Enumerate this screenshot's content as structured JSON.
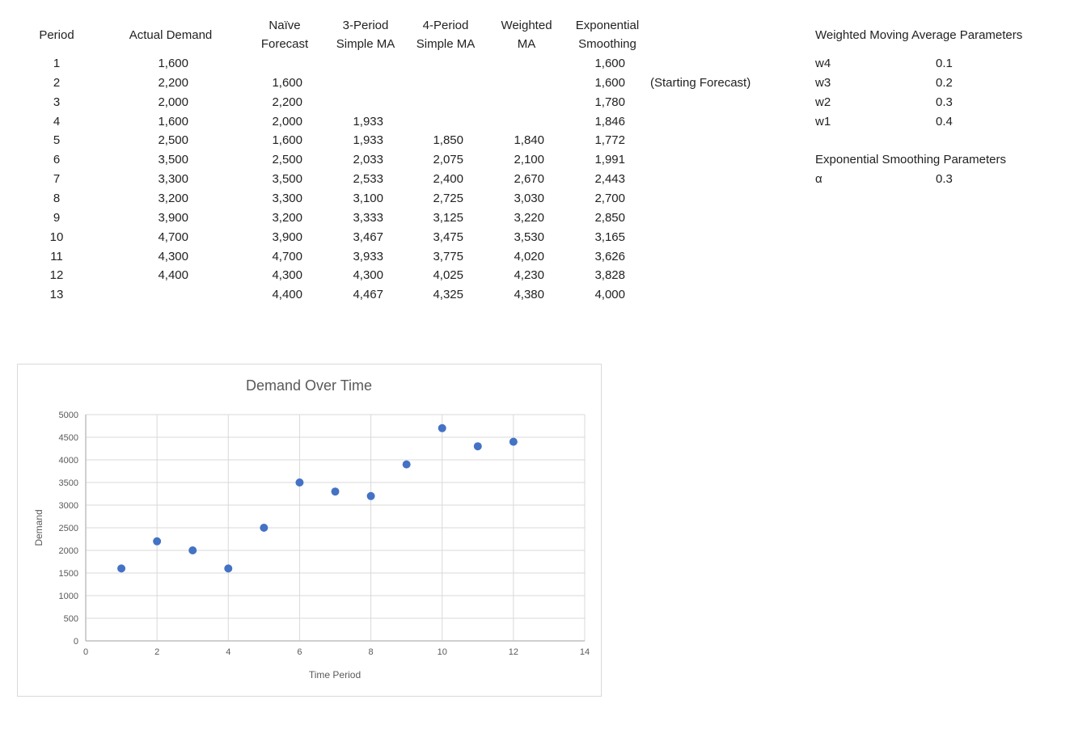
{
  "table": {
    "headers": [
      {
        "line1": "Period",
        "line2": ""
      },
      {
        "line1": "Actual Demand",
        "line2": ""
      },
      {
        "line1": "Naïve",
        "line2": "Forecast"
      },
      {
        "line1": "3-Period",
        "line2": "Simple MA"
      },
      {
        "line1": "4-Period",
        "line2": "Simple MA"
      },
      {
        "line1": "Weighted",
        "line2": "MA"
      },
      {
        "line1": "Exponential",
        "line2": "Smoothing"
      }
    ],
    "rows": [
      {
        "period": "1",
        "actual": "1,600",
        "naive": "",
        "sma3": "",
        "sma4": "",
        "wma": "",
        "es": "1,600",
        "note": ""
      },
      {
        "period": "2",
        "actual": "2,200",
        "naive": "1,600",
        "sma3": "",
        "sma4": "",
        "wma": "",
        "es": "1,600",
        "note": "(Starting Forecast)"
      },
      {
        "period": "3",
        "actual": "2,000",
        "naive": "2,200",
        "sma3": "",
        "sma4": "",
        "wma": "",
        "es": "1,780",
        "note": ""
      },
      {
        "period": "4",
        "actual": "1,600",
        "naive": "2,000",
        "sma3": "1,933",
        "sma4": "",
        "wma": "",
        "es": "1,846",
        "note": ""
      },
      {
        "period": "5",
        "actual": "2,500",
        "naive": "1,600",
        "sma3": "1,933",
        "sma4": "1,850",
        "wma": "1,840",
        "es": "1,772",
        "note": ""
      },
      {
        "period": "6",
        "actual": "3,500",
        "naive": "2,500",
        "sma3": "2,033",
        "sma4": "2,075",
        "wma": "2,100",
        "es": "1,991",
        "note": ""
      },
      {
        "period": "7",
        "actual": "3,300",
        "naive": "3,500",
        "sma3": "2,533",
        "sma4": "2,400",
        "wma": "2,670",
        "es": "2,443",
        "note": ""
      },
      {
        "period": "8",
        "actual": "3,200",
        "naive": "3,300",
        "sma3": "3,100",
        "sma4": "2,725",
        "wma": "3,030",
        "es": "2,700",
        "note": ""
      },
      {
        "period": "9",
        "actual": "3,900",
        "naive": "3,200",
        "sma3": "3,333",
        "sma4": "3,125",
        "wma": "3,220",
        "es": "2,850",
        "note": ""
      },
      {
        "period": "10",
        "actual": "4,700",
        "naive": "3,900",
        "sma3": "3,467",
        "sma4": "3,475",
        "wma": "3,530",
        "es": "3,165",
        "note": ""
      },
      {
        "period": "11",
        "actual": "4,300",
        "naive": "4,700",
        "sma3": "3,933",
        "sma4": "3,775",
        "wma": "4,020",
        "es": "3,626",
        "note": ""
      },
      {
        "period": "12",
        "actual": "4,400",
        "naive": "4,300",
        "sma3": "4,300",
        "sma4": "4,025",
        "wma": "4,230",
        "es": "3,828",
        "note": ""
      },
      {
        "period": "13",
        "actual": "",
        "naive": "4,400",
        "sma3": "4,467",
        "sma4": "4,325",
        "wma": "4,380",
        "es": "4,000",
        "note": ""
      }
    ]
  },
  "wma_params": {
    "title": "Weighted Moving Average Parameters",
    "items": [
      {
        "name": "w4",
        "value": "0.1"
      },
      {
        "name": "w3",
        "value": "0.2"
      },
      {
        "name": "w2",
        "value": "0.3"
      },
      {
        "name": "w1",
        "value": "0.4"
      }
    ]
  },
  "es_params": {
    "title": "Exponential Smoothing Parameters",
    "items": [
      {
        "name": "α",
        "value": "0.3"
      }
    ]
  },
  "chart_data": {
    "type": "scatter",
    "title": "Demand Over Time",
    "xlabel": "Time Period",
    "ylabel": "Demand",
    "xlim": [
      0,
      14
    ],
    "ylim": [
      0,
      5000
    ],
    "xticks": [
      0,
      2,
      4,
      6,
      8,
      10,
      12,
      14
    ],
    "yticks": [
      0,
      500,
      1000,
      1500,
      2000,
      2500,
      3000,
      3500,
      4000,
      4500,
      5000
    ],
    "grid": true,
    "legend": "none",
    "marker_color": "#4472C4",
    "series": [
      {
        "name": "Actual Demand",
        "x": [
          1,
          2,
          3,
          4,
          5,
          6,
          7,
          8,
          9,
          10,
          11,
          12
        ],
        "y": [
          1600,
          2200,
          2000,
          1600,
          2500,
          3500,
          3300,
          3200,
          3900,
          4700,
          4300,
          4400
        ]
      }
    ]
  }
}
